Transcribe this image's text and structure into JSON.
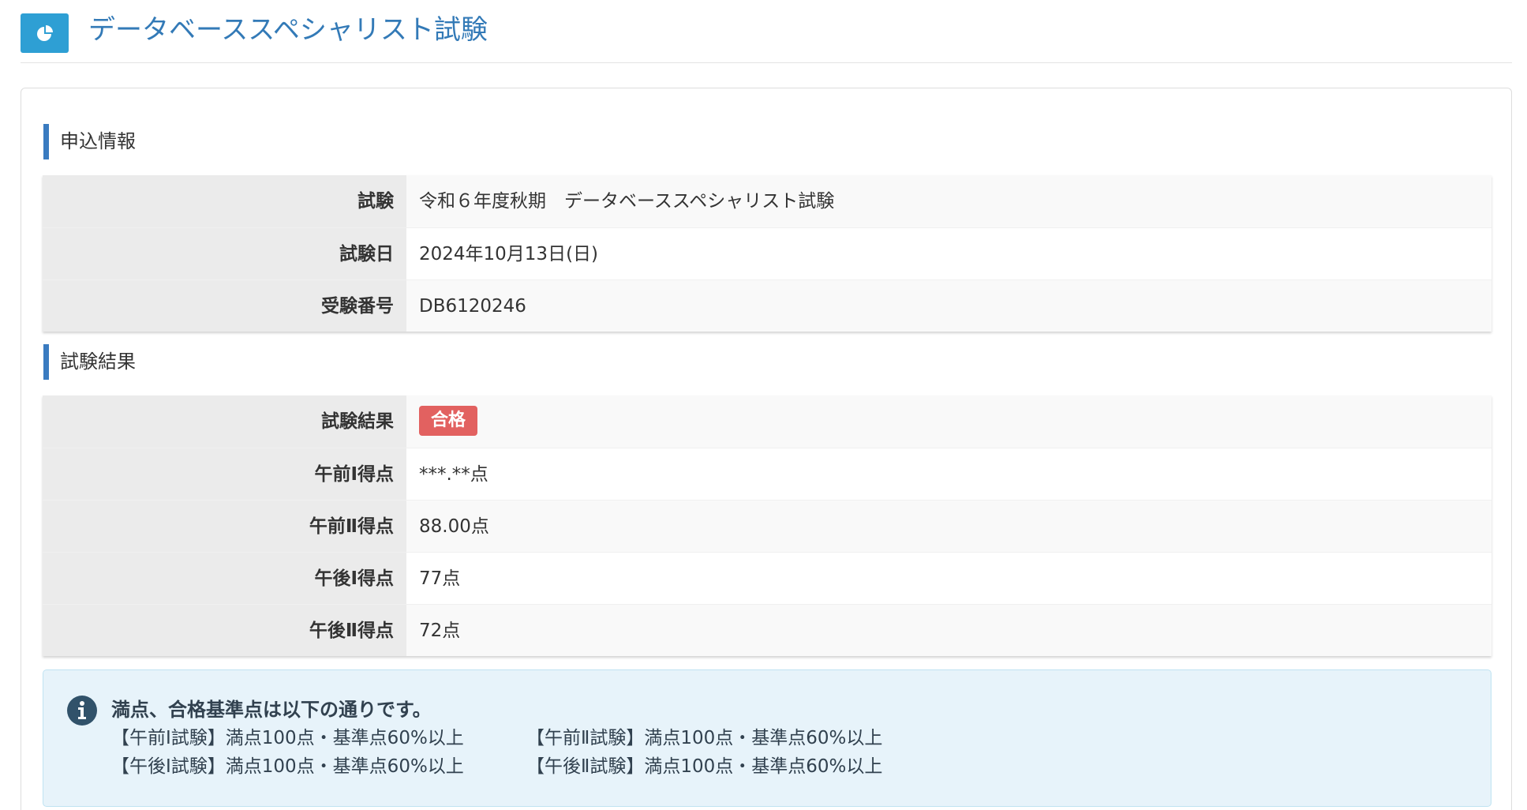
{
  "header": {
    "title": "データベーススペシャリスト試験",
    "icon": "pie-chart-icon",
    "accent_color": "#2e9fd4"
  },
  "application_section": {
    "heading": "申込情報",
    "rows": [
      {
        "label": "試験",
        "value": "令和６年度秋期　データベーススペシャリスト試験"
      },
      {
        "label": "試験日",
        "value": "2024年10月13日(日)"
      },
      {
        "label": "受験番号",
        "value": "DB6120246"
      }
    ]
  },
  "result_section": {
    "heading": "試験結果",
    "result_label": "試験結果",
    "result_badge": "合格",
    "badge_color": "#e26160",
    "rows": [
      {
        "label": "午前Ⅰ得点",
        "value": "***.**点"
      },
      {
        "label": "午前Ⅱ得点",
        "value": "88.00点"
      },
      {
        "label": "午後Ⅰ得点",
        "value": "77点"
      },
      {
        "label": "午後Ⅱ得点",
        "value": "72点"
      }
    ]
  },
  "notice": {
    "icon": "info-circle-icon",
    "title": "満点、合格基準点は以下の通りです。",
    "criteria": [
      "【午前Ⅰ試験】満点100点・基準点60%以上",
      "【午前Ⅱ試験】満点100点・基準点60%以上",
      "【午後Ⅰ試験】満点100点・基準点60%以上",
      "【午後Ⅱ試験】満点100点・基準点60%以上"
    ]
  }
}
